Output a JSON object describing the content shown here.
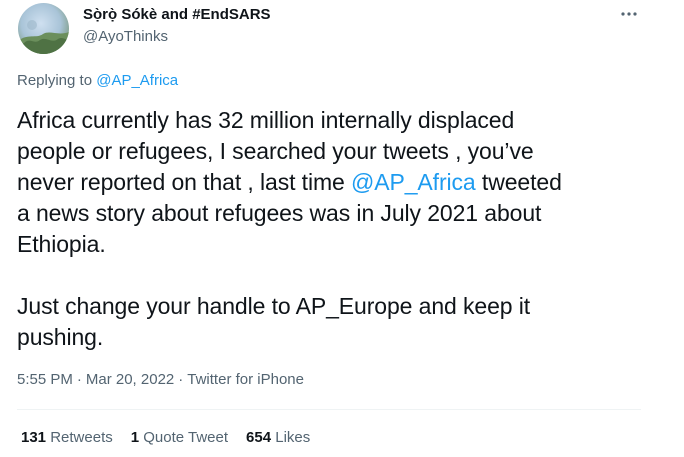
{
  "author": {
    "display_name": "Sọ̀rọ̀ Sókè and #EndSARS",
    "handle": "@AyoThinks"
  },
  "reply_context": {
    "prefix": "Replying to",
    "mention": "@AP_Africa"
  },
  "tweet": {
    "p1_line1": "Africa currently has 32 million internally displaced",
    "p1_line2": "people or refugees, I searched your tweets , you’ve",
    "p1_line3_before": "never reported on that , last time ",
    "p1_line3_mention": "@AP_Africa",
    "p1_line3_after": " tweeted",
    "p1_line4": "a news story about refugees was in July 2021 about",
    "p1_line5": "Ethiopia.",
    "p2_line1": "Just change your handle to AP_Europe and keep it",
    "p2_line2": "pushing."
  },
  "meta": {
    "time": "5:55 PM",
    "separator": "·",
    "date": "Mar 20, 2022",
    "source": "Twitter for iPhone"
  },
  "stats": {
    "retweets_count": "131",
    "retweets_label": "Retweets",
    "quotes_count": "1",
    "quotes_label": "Quote Tweet",
    "likes_count": "654",
    "likes_label": "Likes"
  },
  "colors": {
    "link": "#1d9bf0",
    "text": "#0f1419",
    "secondary": "#536471",
    "divider": "#eff3f4"
  },
  "icons": {
    "more": "more-horizontal-icon",
    "avatar": "avatar-photo"
  }
}
